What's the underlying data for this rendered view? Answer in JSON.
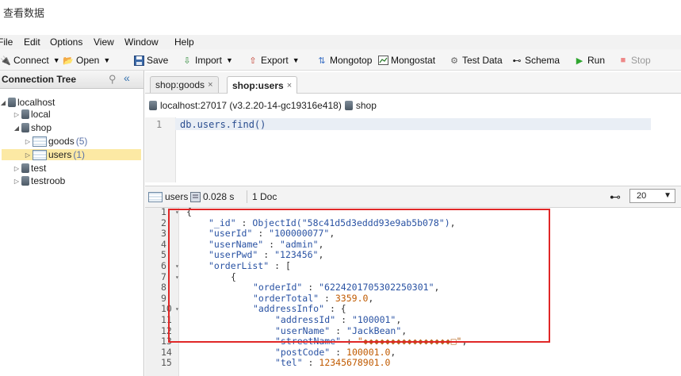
{
  "caption": "查看数据",
  "menu": [
    "File",
    "Edit",
    "Options",
    "View",
    "Window",
    "Help"
  ],
  "toolbar": {
    "connect": "Connect",
    "open": "Open",
    "save": "Save",
    "import": "Import",
    "export": "Export",
    "mongotop": "Mongotop",
    "mongostat": "Mongostat",
    "testdata": "Test Data",
    "schema": "Schema",
    "run": "Run",
    "stop": "Stop"
  },
  "tree": {
    "title": "Connection Tree",
    "localhost": "localhost",
    "local": "local",
    "shop": "shop",
    "goods": "goods",
    "goods_count": "(5)",
    "users": "users",
    "users_count": "(1)",
    "test": "test",
    "testroob": "testroob"
  },
  "tabs": [
    {
      "label": "shop:goods",
      "active": false
    },
    {
      "label": "shop:users",
      "active": true
    }
  ],
  "breadcrumb": {
    "server": "localhost:27017 (v3.2.20-14-gc19316e418)",
    "db": "shop"
  },
  "editor": {
    "line_no": "1",
    "code": "db.users.find()"
  },
  "results_bar": {
    "collection": "users",
    "time": "0.028 s",
    "docs": "1 Doc",
    "page_size": "20"
  },
  "result_lines": [
    {
      "n": "1",
      "fold": "▾",
      "segs": [
        {
          "c": "p",
          "v": "{"
        }
      ]
    },
    {
      "n": "2",
      "fold": "",
      "segs": [
        {
          "c": "k",
          "v": "\"_id\""
        },
        {
          "c": "p",
          "v": " : "
        },
        {
          "c": "s",
          "v": "ObjectId(\"58c41d5d3eddd93e9ab5b078\")"
        },
        {
          "c": "p",
          "v": ","
        }
      ]
    },
    {
      "n": "3",
      "fold": "",
      "segs": [
        {
          "c": "k",
          "v": "\"userId\""
        },
        {
          "c": "p",
          "v": " : "
        },
        {
          "c": "s",
          "v": "\"100000077\""
        },
        {
          "c": "p",
          "v": ","
        }
      ]
    },
    {
      "n": "4",
      "fold": "",
      "segs": [
        {
          "c": "k",
          "v": "\"userName\""
        },
        {
          "c": "p",
          "v": " : "
        },
        {
          "c": "s",
          "v": "\"admin\""
        },
        {
          "c": "p",
          "v": ","
        }
      ]
    },
    {
      "n": "5",
      "fold": "",
      "segs": [
        {
          "c": "k",
          "v": "\"userPwd\""
        },
        {
          "c": "p",
          "v": " : "
        },
        {
          "c": "s",
          "v": "\"123456\""
        },
        {
          "c": "p",
          "v": ","
        }
      ]
    },
    {
      "n": "6",
      "fold": "▾",
      "segs": [
        {
          "c": "k",
          "v": "\"orderList\""
        },
        {
          "c": "p",
          "v": " : ["
        }
      ]
    },
    {
      "n": "7",
      "fold": "▾",
      "segs": [
        {
          "c": "p",
          "v": "{"
        }
      ]
    },
    {
      "n": "8",
      "fold": "",
      "segs": [
        {
          "c": "k",
          "v": "\"orderId\""
        },
        {
          "c": "p",
          "v": " : "
        },
        {
          "c": "s",
          "v": "\"6224201705302250301\""
        },
        {
          "c": "p",
          "v": ","
        }
      ]
    },
    {
      "n": "9",
      "fold": "",
      "segs": [
        {
          "c": "k",
          "v": "\"orderTotal\""
        },
        {
          "c": "p",
          "v": " : "
        },
        {
          "c": "num",
          "v": "3359.0"
        },
        {
          "c": "p",
          "v": ","
        }
      ]
    },
    {
      "n": "10",
      "fold": "▾",
      "segs": [
        {
          "c": "k",
          "v": "\"addressInfo\""
        },
        {
          "c": "p",
          "v": " : {"
        }
      ]
    },
    {
      "n": "11",
      "fold": "",
      "segs": [
        {
          "c": "k",
          "v": "\"addressId\""
        },
        {
          "c": "p",
          "v": " : "
        },
        {
          "c": "s",
          "v": "\"100001\""
        },
        {
          "c": "p",
          "v": ","
        }
      ]
    },
    {
      "n": "12",
      "fold": "",
      "segs": [
        {
          "c": "k",
          "v": "\"userName\""
        },
        {
          "c": "p",
          "v": " : "
        },
        {
          "c": "s",
          "v": "\"JackBean\""
        },
        {
          "c": "p",
          "v": ","
        }
      ]
    },
    {
      "n": "13",
      "fold": "",
      "segs": [
        {
          "c": "k",
          "v": "\"streetName\""
        },
        {
          "c": "p",
          "v": " : "
        },
        {
          "c": "g",
          "v": "\"◆◆◆◆◆◆◆◆◆◆◆◆◆◆◆◆□\""
        },
        {
          "c": "p",
          "v": ","
        }
      ]
    },
    {
      "n": "14",
      "fold": "",
      "segs": [
        {
          "c": "k",
          "v": "\"postCode\""
        },
        {
          "c": "p",
          "v": " : "
        },
        {
          "c": "num",
          "v": "100001.0"
        },
        {
          "c": "p",
          "v": ","
        }
      ]
    },
    {
      "n": "15",
      "fold": "",
      "segs": [
        {
          "c": "k",
          "v": "\"tel\""
        },
        {
          "c": "p",
          "v": " : "
        },
        {
          "c": "num",
          "v": "12345678901.0"
        }
      ]
    }
  ]
}
